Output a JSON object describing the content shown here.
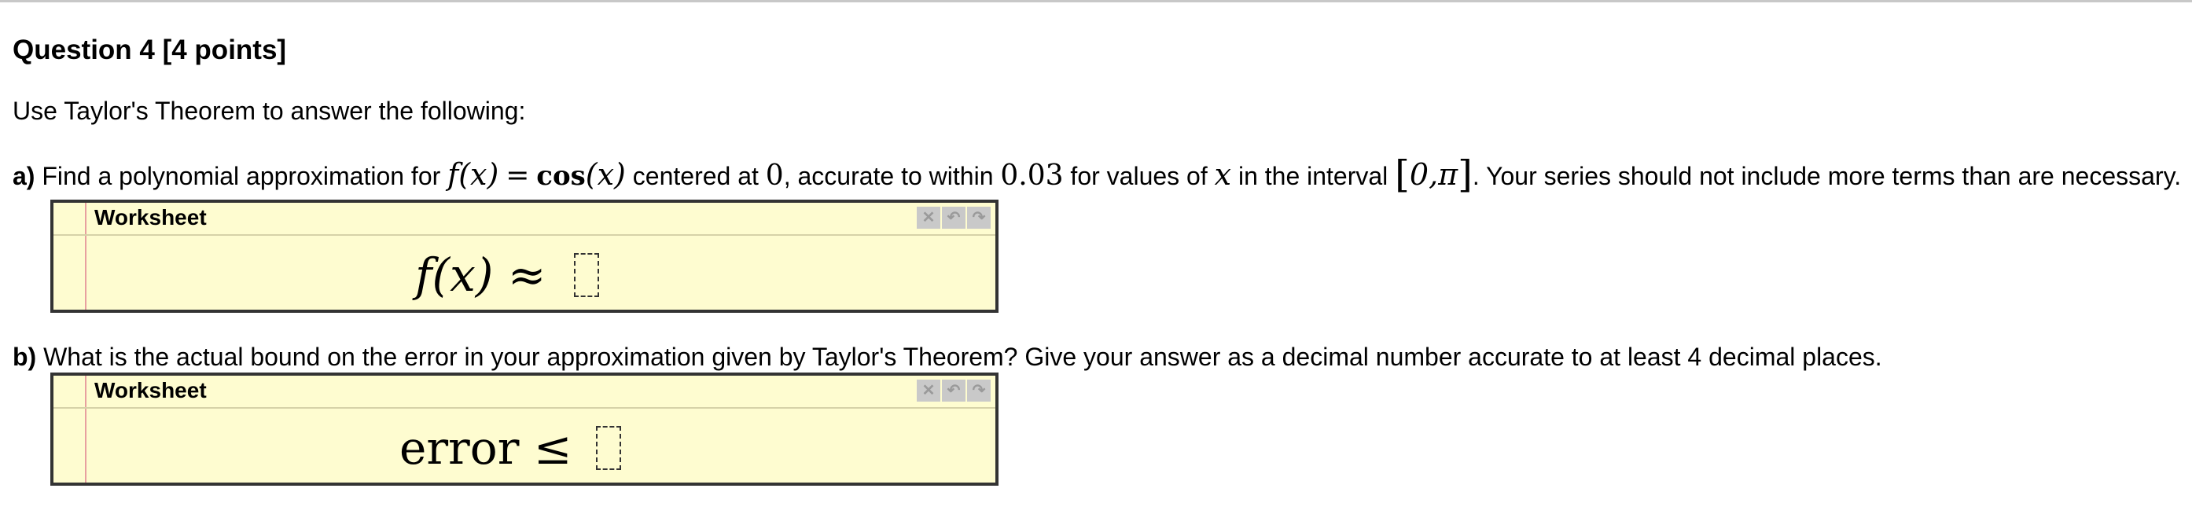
{
  "question": {
    "title": "Question 4 [4 points]",
    "intro": "Use Taylor's Theorem to answer the following:"
  },
  "part_a": {
    "label": "a)",
    "text_1": "Find a polynomial approximation for",
    "fx": "f(x)",
    "eq": "=",
    "cos": "cos",
    "arg": "(x)",
    "text_2": "centered at",
    "center": "0",
    "text_3": ", accurate to within",
    "tolerance": "0.03",
    "text_4": "for values of",
    "var": "x",
    "text_5": "in the interval",
    "lbracket": "[",
    "interval": "0,π",
    "rbracket": "]",
    "text_6": ". Your series should not include more terms than are necessary."
  },
  "worksheet_a": {
    "title": "Worksheet",
    "expr_left": "f(x)",
    "expr_sym": "≈",
    "answer": ""
  },
  "part_b": {
    "label": "b)",
    "text": "What is the actual bound on the error in your approximation given by Taylor's Theorem? Give your answer as a decimal number accurate to at least 4 decimal places."
  },
  "worksheet_b": {
    "title": "Worksheet",
    "expr_left": "error",
    "expr_sym": "≤",
    "answer": ""
  },
  "tools": {
    "close_glyph": "✕",
    "undo_glyph": "↶",
    "redo_glyph": "↷"
  }
}
